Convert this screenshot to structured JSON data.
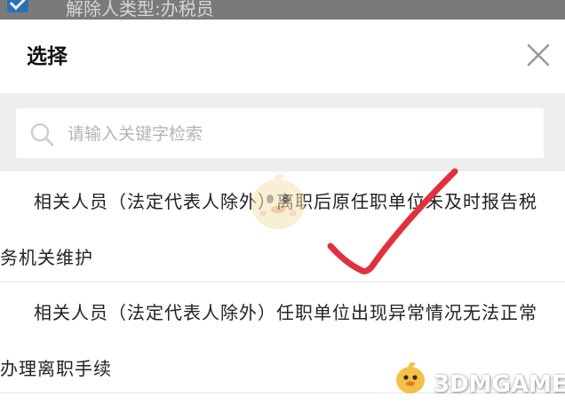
{
  "background": {
    "field_text": "解除人类型:办税员",
    "checkbox_checked": true
  },
  "dialog": {
    "title": "选择",
    "close_icon": "close-icon"
  },
  "search": {
    "placeholder": "请输入关键字检索",
    "value": "",
    "icon": "search-icon"
  },
  "options": [
    {
      "line1": "相关人员（法定代表人除外）离职后原任职单位未及时报告税",
      "line2": "务机关维护"
    },
    {
      "line1": "相关人员（法定代表人除外）任职单位出现异常情况无法正常",
      "line2": "办理离职手续"
    }
  ],
  "annotation": {
    "checkmark_color": "#e0323c"
  },
  "watermark": {
    "text": "3DMGAME"
  }
}
